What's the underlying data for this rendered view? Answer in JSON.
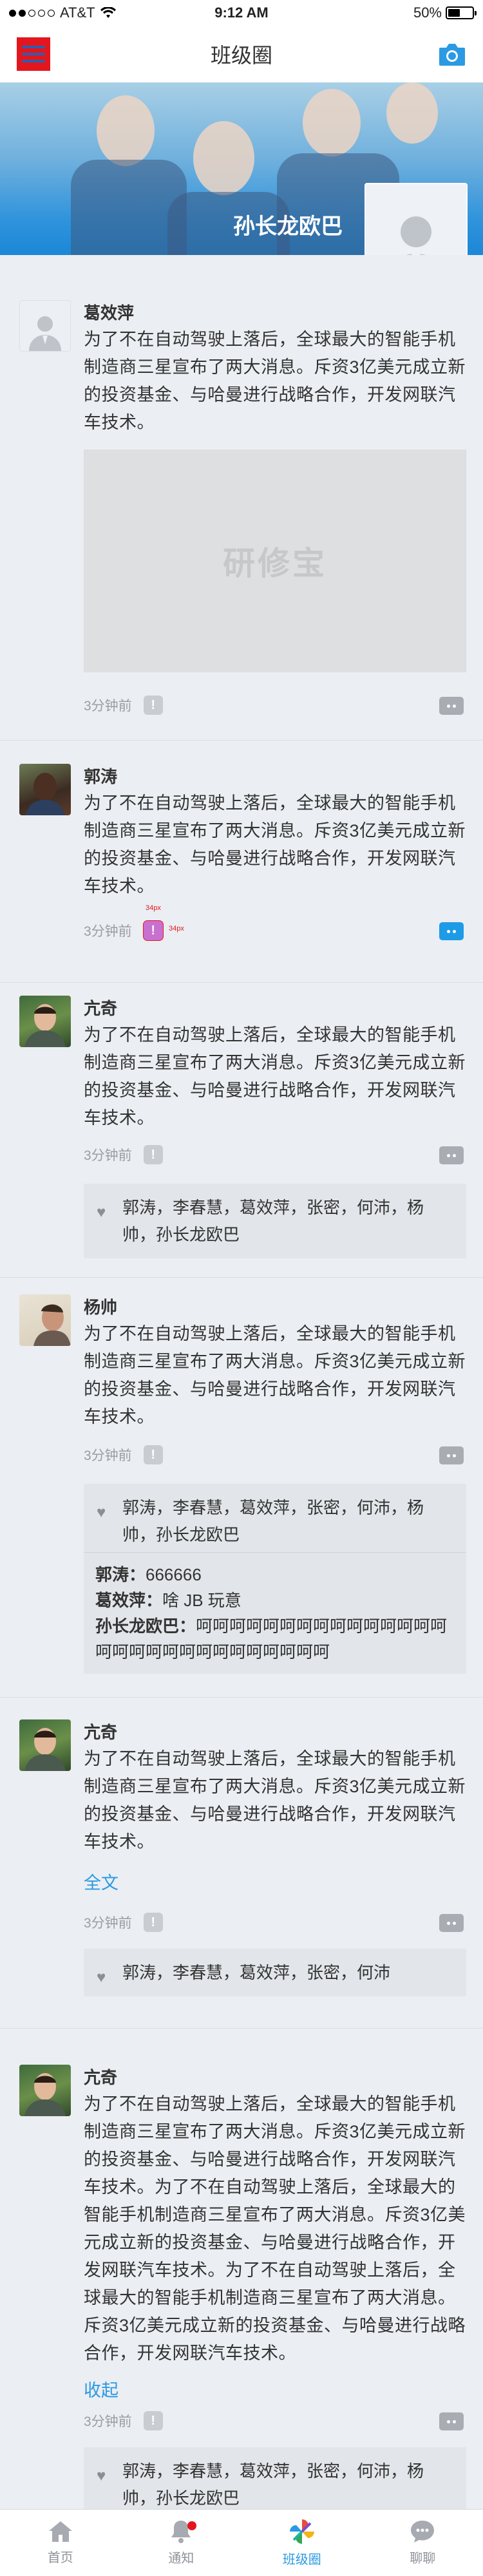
{
  "status_bar": {
    "carrier": "AT&T",
    "time": "9:12 AM",
    "battery": "50%",
    "battery_level": 0.5
  },
  "nav": {
    "title": "班级圈"
  },
  "banner": {
    "user_name": "孙长龙欧巴"
  },
  "posts": [
    {
      "author": "葛效萍",
      "content": "为了不在自动驾驶上落后，全球最大的智能手机制造商三星宣布了两大消息。斥资3亿美元成立新的投资基金、与哈曼进行战略合作，开发网联汽车技术。",
      "image_watermark": "研修宝",
      "time": "3分钟前"
    },
    {
      "author": "郭涛",
      "content": "为了不在自动驾驶上落后，全球最大的智能手机制造商三星宣布了两大消息。斥资3亿美元成立新的投资基金、与哈曼进行战略合作，开发网联汽车技术。",
      "time": "3分钟前",
      "dim_labels": [
        "34px",
        "34px"
      ]
    },
    {
      "author": "亢奇",
      "content": "为了不在自动驾驶上落后，全球最大的智能手机制造商三星宣布了两大消息。斥资3亿美元成立新的投资基金、与哈曼进行战略合作，开发网联汽车技术。",
      "time": "3分钟前",
      "likes": "郭涛，李春慧，葛效萍，张密，何沛，杨帅，孙长龙欧巴"
    },
    {
      "author": "杨帅",
      "content": "为了不在自动驾驶上落后，全球最大的智能手机制造商三星宣布了两大消息。斥资3亿美元成立新的投资基金、与哈曼进行战略合作，开发网联汽车技术。",
      "time": "3分钟前",
      "likes": "郭涛，李春慧，葛效萍，张密，何沛，杨帅，孙长龙欧巴",
      "comments": [
        {
          "name": "郭涛：",
          "text": "666666"
        },
        {
          "name": "葛效萍：",
          "text": "啥 JB 玩意"
        },
        {
          "name": "孙长龙欧巴：",
          "text": "呵呵呵呵呵呵呵呵呵呵呵呵呵呵呵呵呵呵呵呵呵呵呵呵呵呵呵呵呵"
        }
      ]
    },
    {
      "author": "亢奇",
      "content": "为了不在自动驾驶上落后，全球最大的智能手机制造商三星宣布了两大消息。斥资3亿美元成立新的投资基金、与哈曼进行战略合作，开发网联汽车技术。",
      "expand_link": "全文",
      "time": "3分钟前",
      "likes": "郭涛，李春慧，葛效萍，张密，何沛"
    },
    {
      "author": "亢奇",
      "content": "为了不在自动驾驶上落后，全球最大的智能手机制造商三星宣布了两大消息。斥资3亿美元成立新的投资基金、与哈曼进行战略合作，开发网联汽车技术。为了不在自动驾驶上落后，全球最大的智能手机制造商三星宣布了两大消息。斥资3亿美元成立新的投资基金、与哈曼进行战略合作，开发网联汽车技术。为了不在自动驾驶上落后，全球最大的智能手机制造商三星宣布了两大消息。斥资3亿美元成立新的投资基金、与哈曼进行战略合作，开发网联汽车技术。",
      "collapse_link": "收起",
      "time": "3分钟前",
      "likes": "郭涛，李春慧，葛效萍，张密，何沛，杨帅，孙长龙欧巴"
    }
  ],
  "tabbar": {
    "tabs": [
      {
        "label": "首页",
        "icon": "home-icon"
      },
      {
        "label": "通知",
        "icon": "bell-icon"
      },
      {
        "label": "班级圈",
        "icon": "pinwheel-icon"
      },
      {
        "label": "聊聊",
        "icon": "chat-icon"
      }
    ],
    "active": "班级圈"
  },
  "colors": {
    "accent": "#2b9ae3",
    "menu_red": "#e3161e",
    "background": "#ebeef2"
  }
}
